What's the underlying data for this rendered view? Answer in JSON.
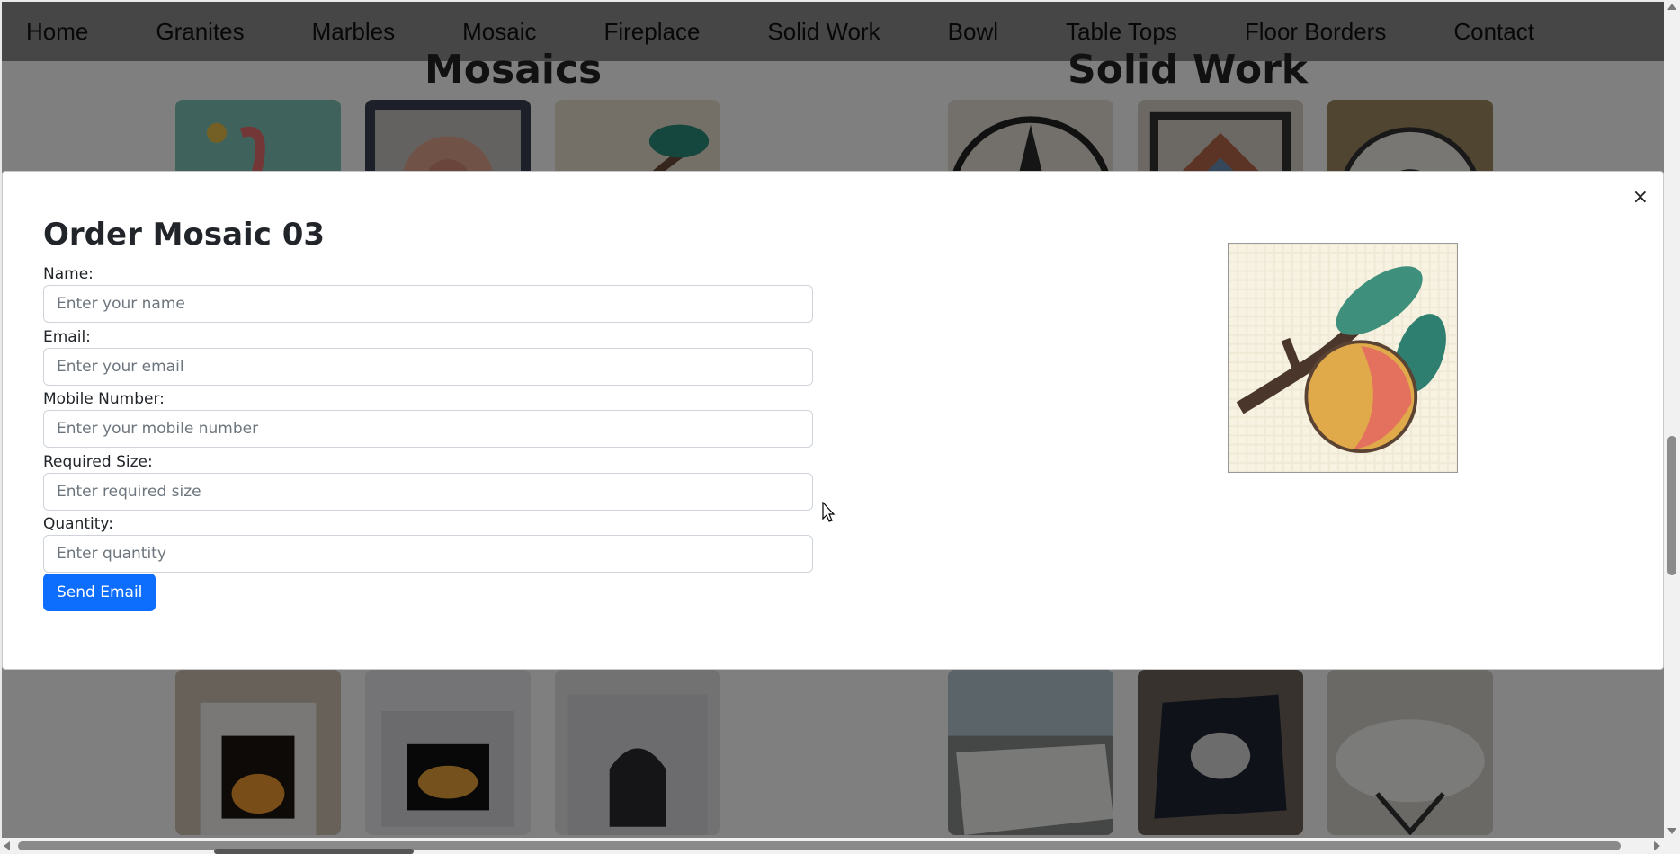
{
  "nav": {
    "items": [
      {
        "label": "Home"
      },
      {
        "label": "Granites"
      },
      {
        "label": "Marbles"
      },
      {
        "label": "Mosaic"
      },
      {
        "label": "Fireplace"
      },
      {
        "label": "Solid Work"
      },
      {
        "label": "Bowl"
      },
      {
        "label": "Table Tops"
      },
      {
        "label": "Floor Borders"
      },
      {
        "label": "Contact"
      }
    ]
  },
  "sections": {
    "mosaics_title": "Mosaics",
    "solid_work_title": "Solid Work"
  },
  "modal": {
    "title": "Order Mosaic 03",
    "close_label": "×",
    "fields": {
      "name": {
        "label": "Name:",
        "placeholder": "Enter your name",
        "value": ""
      },
      "email": {
        "label": "Email:",
        "placeholder": "Enter your email",
        "value": ""
      },
      "mobile": {
        "label": "Mobile Number:",
        "placeholder": "Enter your mobile number",
        "value": ""
      },
      "size": {
        "label": "Required Size:",
        "placeholder": "Enter required size",
        "value": ""
      },
      "quantity": {
        "label": "Quantity:",
        "placeholder": "Enter quantity",
        "value": ""
      }
    },
    "submit_label": "Send Email",
    "image_icon": "mosaic-fruit-image"
  },
  "colors": {
    "nav_bg": "#8c8c8c",
    "primary_button": "#0d6efd",
    "backdrop": "rgba(0,0,0,0.5)"
  }
}
